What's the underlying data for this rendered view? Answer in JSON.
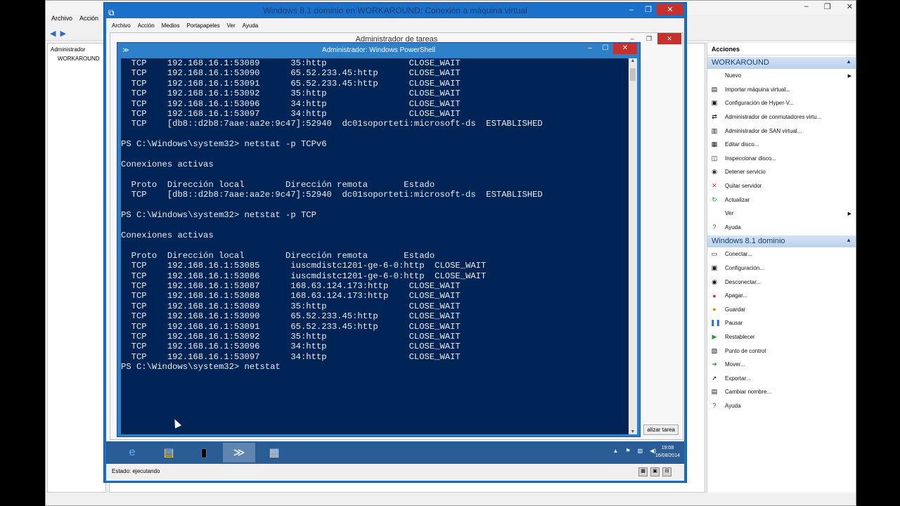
{
  "hyperv": {
    "menu": [
      "Archivo",
      "Acción"
    ],
    "tree": [
      "Administrador",
      "WORKAROUND"
    ],
    "actions_title": "Acciones",
    "host_group": "WORKAROUND",
    "host_actions": [
      {
        "label": "Nuevo",
        "icon": "new-icon",
        "submenu": true
      },
      {
        "label": "Importar máquina virtual...",
        "icon": "import-icon"
      },
      {
        "label": "Configuración de Hyper-V...",
        "icon": "settings-icon"
      },
      {
        "label": "Administrador de conmutadores virtu...",
        "icon": "switch-icon"
      },
      {
        "label": "Administrador de SAN virtual...",
        "icon": "san-icon"
      },
      {
        "label": "Editar disco...",
        "icon": "edit-disk-icon"
      },
      {
        "label": "Inspeccionar disco...",
        "icon": "inspect-disk-icon"
      },
      {
        "label": "Detener servicio",
        "icon": "stop-icon"
      },
      {
        "label": "Quitar servidor",
        "icon": "remove-icon"
      },
      {
        "label": "Actualizar",
        "icon": "refresh-icon"
      },
      {
        "label": "Ver",
        "icon": "",
        "submenu": true
      },
      {
        "label": "Ayuda",
        "icon": "help-icon"
      }
    ],
    "vm_group": "Windows 8.1 dominio",
    "vm_actions": [
      {
        "label": "Conectar...",
        "icon": "connect-icon"
      },
      {
        "label": "Configuración...",
        "icon": "settings-icon"
      },
      {
        "label": "Desconectar...",
        "icon": "turnoff-icon"
      },
      {
        "label": "Apagar...",
        "icon": "shutdown-icon"
      },
      {
        "label": "Guardar",
        "icon": "save-icon"
      },
      {
        "label": "Pausar",
        "icon": "pause-icon"
      },
      {
        "label": "Restablecer",
        "icon": "reset-icon"
      },
      {
        "label": "Punto de control",
        "icon": "checkpoint-icon"
      },
      {
        "label": "Mover...",
        "icon": "move-icon"
      },
      {
        "label": "Exportar...",
        "icon": "export-icon"
      },
      {
        "label": "Cambiar nombre...",
        "icon": "rename-icon"
      },
      {
        "label": "Ayuda",
        "icon": "help-icon"
      }
    ]
  },
  "vm": {
    "title": "Windows 8.1 dominio en WORKAROUND: Conexión a máquina virtual",
    "menu": [
      "Archivo",
      "Acción",
      "Medios",
      "Portapapeles",
      "Ver",
      "Ayuda"
    ],
    "status": "Estado: ejecutando",
    "taskmanager_title": "Administrador de tareas",
    "taskmanager_button": "alizar tarea",
    "clock_time": "19:08",
    "clock_date": "16/08/2014"
  },
  "powershell": {
    "title": "Administrador: Windows PowerShell",
    "console_lines": [
      "  TCP    192.168.16.1:53089      35:http                CLOSE_WAIT",
      "  TCP    192.168.16.1:53090      65.52.233.45:http      CLOSE_WAIT",
      "  TCP    192.168.16.1:53091      65.52.233.45:http      CLOSE_WAIT",
      "  TCP    192.168.16.1:53092      35:http                CLOSE_WAIT",
      "  TCP    192.168.16.1:53096      34:http                CLOSE_WAIT",
      "  TCP    192.168.16.1:53097      34:http                CLOSE_WAIT",
      "  TCP    [db8::d2b8:7aae:aa2e:9c47]:52940  dc01soporteti:microsoft-ds  ESTABLISHED",
      "",
      "PS C:\\Windows\\system32> netstat -p TCPv6",
      "",
      "Conexiones activas",
      "",
      "  Proto  Dirección local        Dirección remota       Estado",
      "  TCP    [db8::d2b8:7aae:aa2e:9c47]:52940  dc01soporteti:microsoft-ds  ESTABLISHED",
      "",
      "PS C:\\Windows\\system32> netstat -p TCP",
      "",
      "Conexiones activas",
      "",
      "  Proto  Dirección local        Dirección remota       Estado",
      "  TCP    192.168.16.1:53085      iuscmdistc1201-ge-6-0:http  CLOSE_WAIT",
      "  TCP    192.168.16.1:53086      iuscmdistc1201-ge-6-0:http  CLOSE_WAIT",
      "  TCP    192.168.16.1:53087      168.63.124.173:http    CLOSE_WAIT",
      "  TCP    192.168.16.1:53088      168.63.124.173:http    CLOSE_WAIT",
      "  TCP    192.168.16.1:53089      35:http                CLOSE_WAIT",
      "  TCP    192.168.16.1:53090      65.52.233.45:http      CLOSE_WAIT",
      "  TCP    192.168.16.1:53091      65.52.233.45:http      CLOSE_WAIT",
      "  TCP    192.168.16.1:53092      35:http                CLOSE_WAIT",
      "  TCP    192.168.16.1:53096      34:http                CLOSE_WAIT",
      "  TCP    192.168.16.1:53097      34:http                CLOSE_WAIT",
      "PS C:\\Windows\\system32> netstat"
    ]
  },
  "taskbar": {
    "apps": [
      {
        "name": "ie-icon",
        "glyph": "e"
      },
      {
        "name": "explorer-icon",
        "glyph": "▤"
      },
      {
        "name": "cmd-icon",
        "glyph": "▮"
      },
      {
        "name": "powershell-icon",
        "glyph": "≫"
      },
      {
        "name": "server-manager-icon",
        "glyph": "▦"
      }
    ]
  },
  "colors": {
    "console_bg": "#012456",
    "console_fg": "#eeedf0",
    "vm_frame": "#1b70c9",
    "close_red": "#c7312d"
  }
}
